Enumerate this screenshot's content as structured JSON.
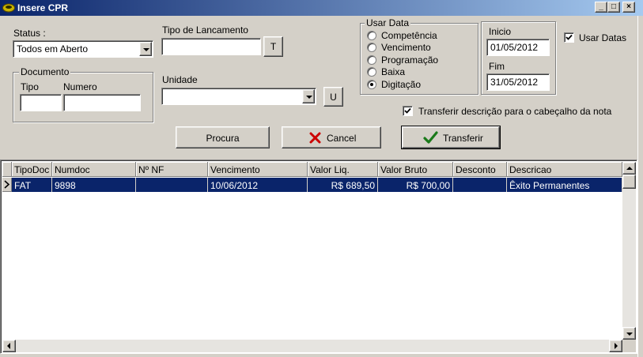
{
  "window": {
    "title": "Insere CPR",
    "icon": "app-logo-icon",
    "controls": [
      "minimize-icon",
      "maximize-icon",
      "close-icon"
    ]
  },
  "status": {
    "label": "Status :",
    "value": "Todos em Aberto"
  },
  "tipo_lancamento": {
    "label": "Tipo de Lancamento",
    "value": "",
    "button_label": "T"
  },
  "documento": {
    "legend": "Documento",
    "tipo_label": "Tipo",
    "tipo_value": "",
    "numero_label": "Numero",
    "numero_value": ""
  },
  "unidade": {
    "label": "Unidade",
    "value": "",
    "button_label": "U"
  },
  "usar_data": {
    "legend": "Usar Data",
    "options": [
      "Competência",
      "Vencimento",
      "Programação",
      "Baixa",
      "Digitação"
    ],
    "selected": "Digitação"
  },
  "periodo": {
    "inicio_label": "Inicio",
    "inicio_value": "01/05/2012",
    "fim_label": "Fim",
    "fim_value": "31/05/2012"
  },
  "usar_datas": {
    "label": "Usar Datas",
    "checked": true
  },
  "transferir_descricao": {
    "label": "Transferir descrição para o cabeçalho da nota",
    "checked": true
  },
  "buttons": {
    "procura": "Procura",
    "cancel": "Cancel",
    "transferir": "Transferir"
  },
  "grid": {
    "columns": [
      "TipoDoc",
      "Numdoc",
      "Nº NF",
      "Vencimento",
      "Valor Liq.",
      "Valor Bruto",
      "Desconto",
      "Descricao"
    ],
    "rows": [
      {
        "tipodoc": "FAT",
        "numdoc": "9898",
        "nf": "",
        "vencimento": "10/06/2012",
        "valor_liq": "R$ 689,50",
        "valor_bruto": "R$ 700,00",
        "desconto": "",
        "descricao": "Êxito Permanentes"
      }
    ]
  },
  "colors": {
    "titlebar_start": "#0a246a",
    "titlebar_end": "#a6caf0",
    "selection": "#0a246a",
    "window_bg": "#d4d0c8",
    "cancel_icon": "#cc0000",
    "check_icon": "#1a7a1a"
  }
}
